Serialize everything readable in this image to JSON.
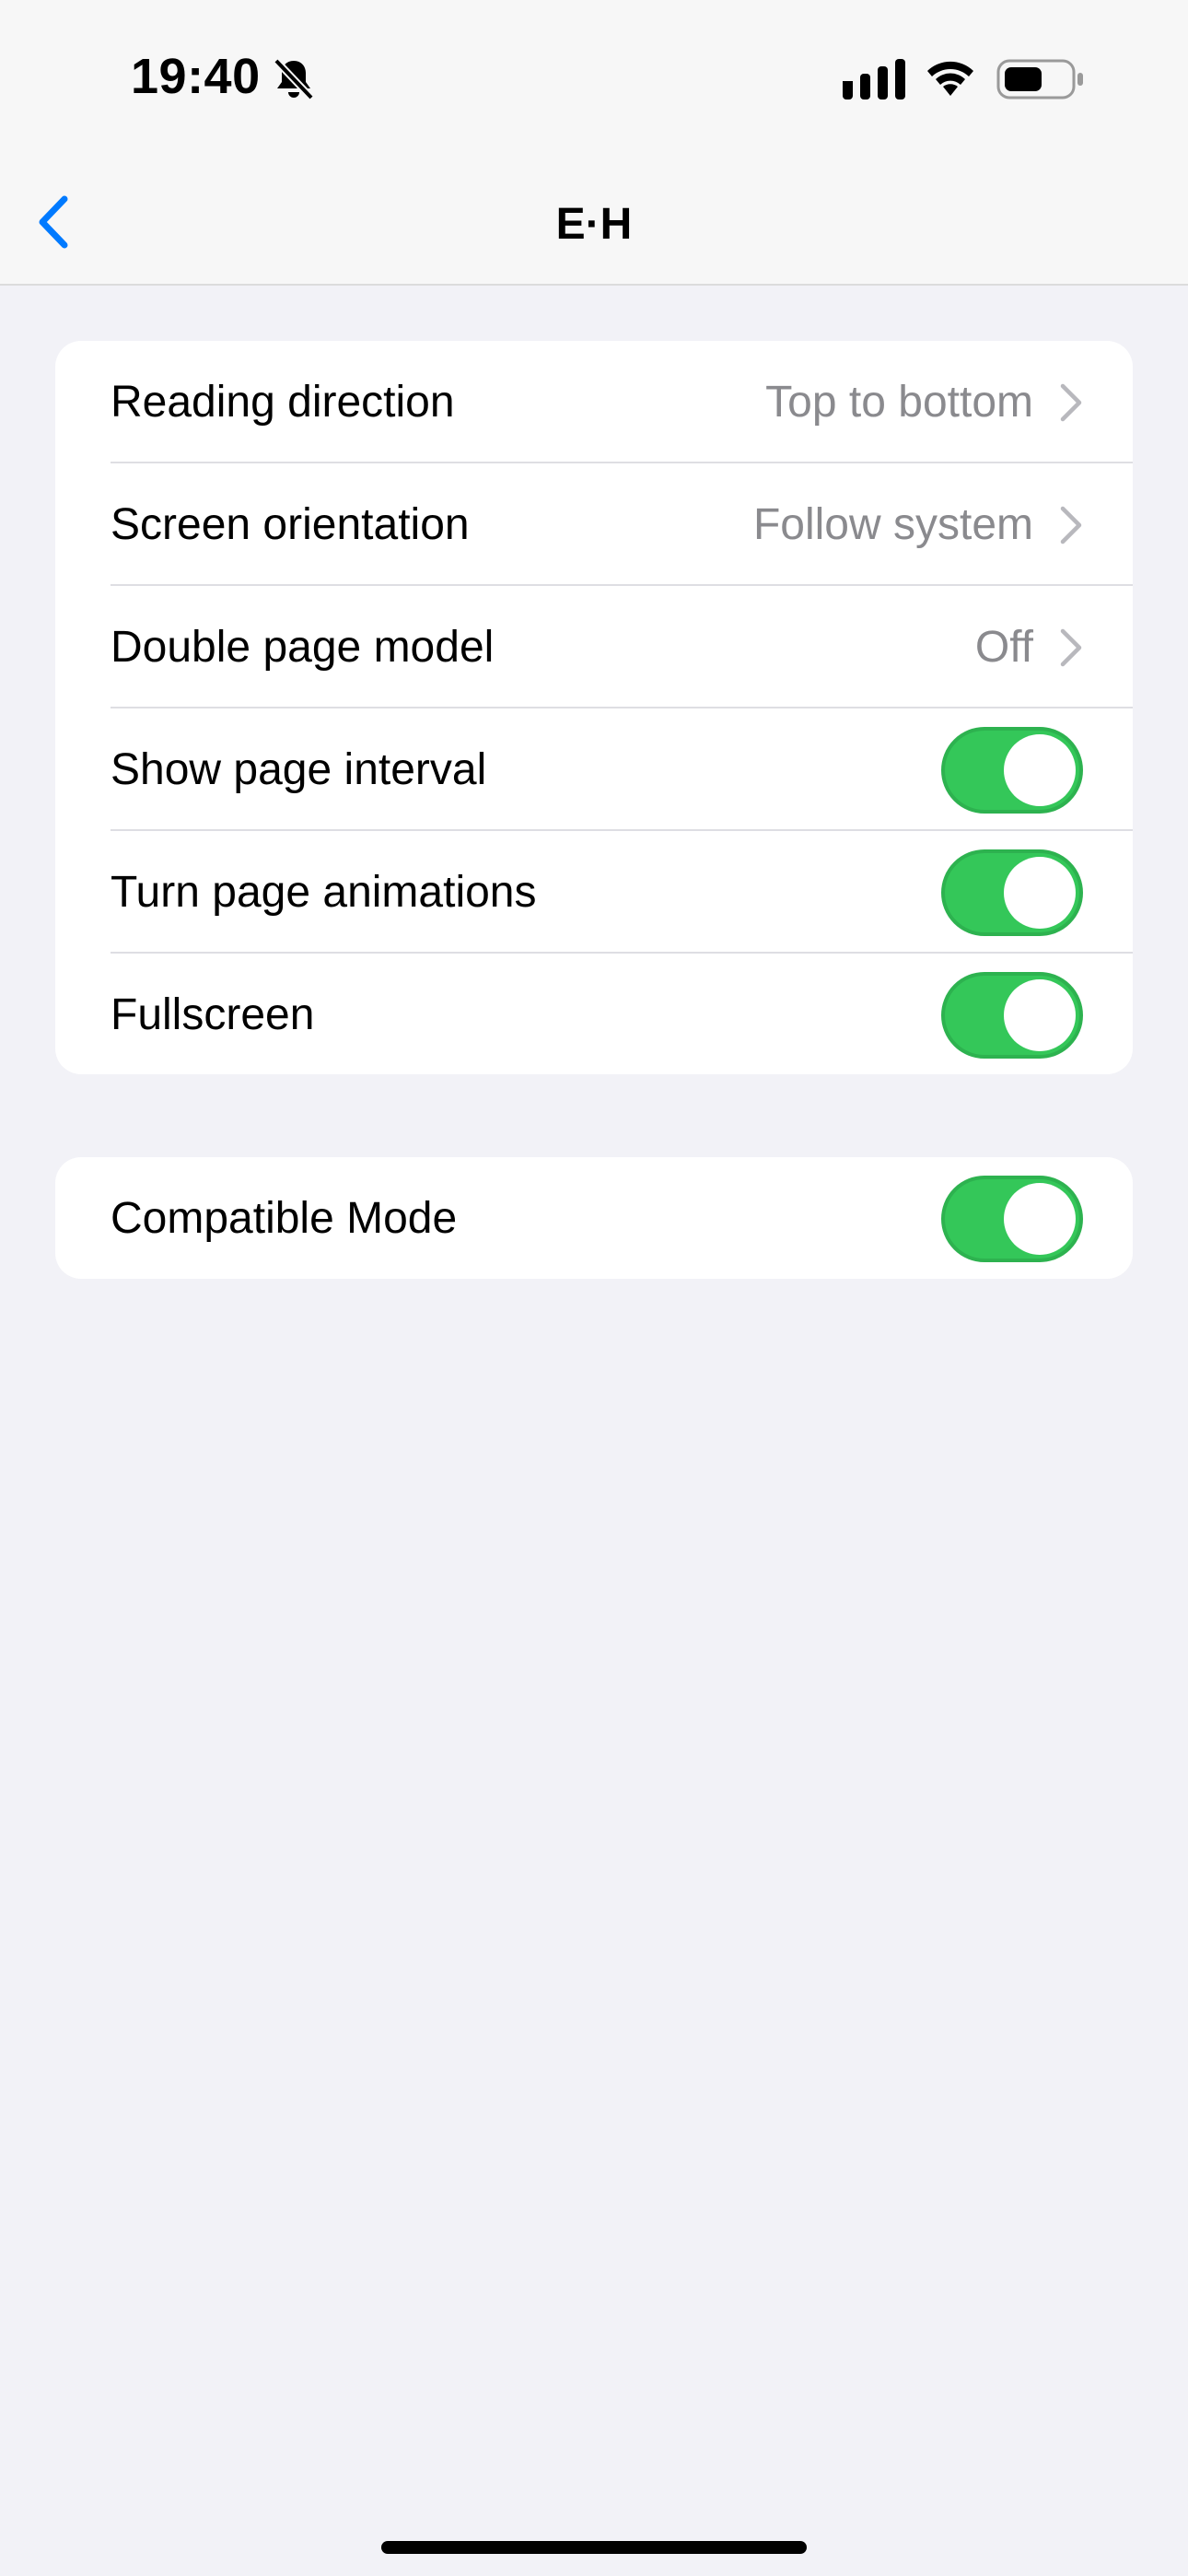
{
  "status_bar": {
    "time": "19:40",
    "icons": [
      "bell-slash-icon",
      "cellular-signal-icon",
      "wifi-icon",
      "battery-icon"
    ]
  },
  "nav": {
    "back_icon": "chevron-left-icon",
    "title": "E·H"
  },
  "groups": [
    {
      "rows": [
        {
          "label": "Reading direction",
          "value": "Top to bottom",
          "control": "disclosure"
        },
        {
          "label": "Screen orientation",
          "value": "Follow system",
          "control": "disclosure"
        },
        {
          "label": "Double page model",
          "value": "Off",
          "control": "disclosure"
        },
        {
          "label": "Show page interval",
          "control": "toggle",
          "on": true
        },
        {
          "label": "Turn page animations",
          "control": "toggle",
          "on": true
        },
        {
          "label": "Fullscreen",
          "control": "toggle",
          "on": true
        }
      ]
    },
    {
      "rows": [
        {
          "label": "Compatible Mode",
          "control": "toggle",
          "on": true
        }
      ]
    }
  ],
  "colors": {
    "accent": "#007aff",
    "toggle_on": "#34c759",
    "background": "#f2f2f7",
    "secondary_text": "#8a8a8e"
  }
}
